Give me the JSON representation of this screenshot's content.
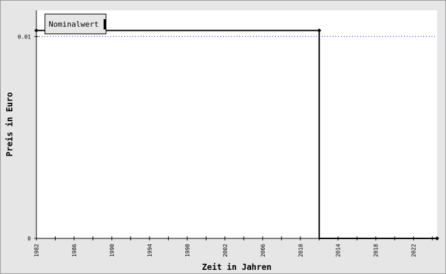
{
  "chart_data": {
    "type": "line",
    "title": "",
    "xlabel": "Zeit in Jahren",
    "ylabel": "Preis in Euro",
    "xlim": [
      1982,
      2024.5
    ],
    "ylim": [
      0,
      0.0113
    ],
    "x_ticks": [
      1982,
      1984,
      1986,
      1988,
      1990,
      1992,
      1994,
      1996,
      1998,
      2000,
      2002,
      2004,
      2006,
      2008,
      2010,
      2012,
      2014,
      2016,
      2018,
      2020,
      2022,
      2024
    ],
    "x_tick_labels": [
      "1982",
      "1986",
      "1990",
      "1994",
      "1998",
      "2002",
      "2006",
      "2010",
      "2014",
      "2018",
      "2022"
    ],
    "y_ticks": [
      {
        "value": 0,
        "label": "0"
      },
      {
        "value": 0.01,
        "label": "0.01"
      }
    ],
    "reference_line": {
      "value": 0.01,
      "style": "dotted",
      "color": "#0000cc"
    },
    "legend": {
      "label": "Nominalwert",
      "position": "top-left",
      "color": "#000000"
    },
    "series": [
      {
        "name": "Nominalwert",
        "color": "#000000",
        "step": true,
        "points": [
          {
            "x": 1982,
            "y": 0.0103
          },
          {
            "x": 2012,
            "y": 0.0103
          },
          {
            "x": 2012,
            "y": 0
          },
          {
            "x": 2024.5,
            "y": 0
          }
        ],
        "markers": [
          {
            "x": 1982,
            "y": 0.0103
          },
          {
            "x": 2012,
            "y": 0.0103
          },
          {
            "x": 2024.5,
            "y": 0
          }
        ]
      }
    ],
    "grid": false
  }
}
